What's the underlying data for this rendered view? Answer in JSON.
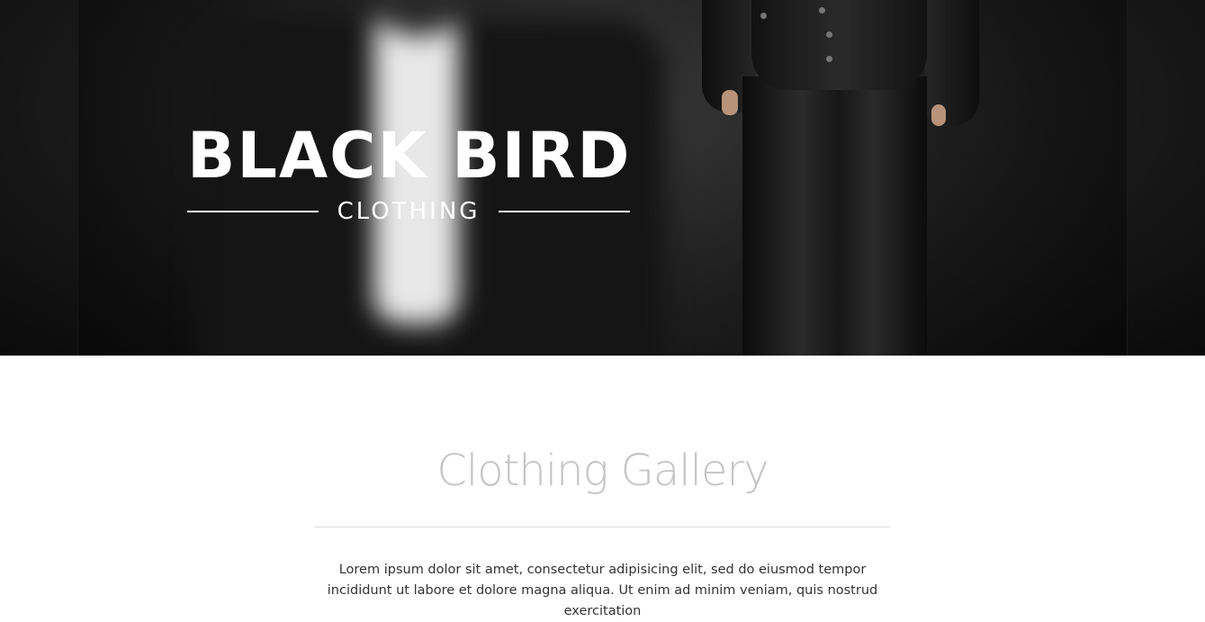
{
  "hero": {
    "brand_title": "BLACK BIRD",
    "brand_subtitle": "CLOTHING"
  },
  "gallery": {
    "title": "Clothing Gallery",
    "description": "Lorem ipsum dolor sit amet, consectetur adipisicing elit, sed do eiusmod tempor incididunt ut labore et dolore magna aliqua. Ut enim ad minim veniam, quis nostrud exercitation"
  },
  "colors": {
    "hero_background": "#1c1c1c",
    "brand_text": "#ffffff",
    "gallery_title": "#c4c4c4",
    "body_text": "#333333"
  }
}
